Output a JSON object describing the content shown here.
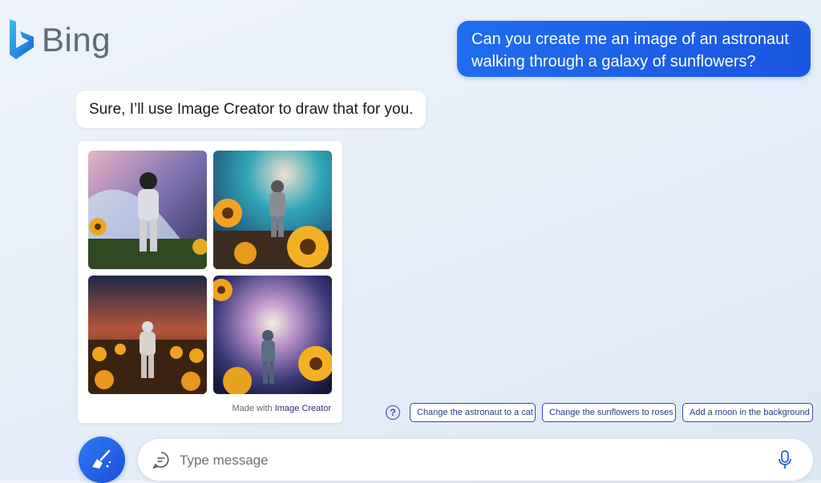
{
  "logo": {
    "text": "Bing"
  },
  "conversation": {
    "user_message": "Can you create me an image of an astronaut walking through a galaxy of sunflowers?",
    "bot_message": "Sure, I’ll use Image Creator to draw that for you.",
    "image_card": {
      "footer_prefix": "Made with",
      "footer_link": "Image Creator"
    }
  },
  "suggestions": [
    {
      "label": "Change the astronaut to a cat"
    },
    {
      "label": "Change the sunflowers to roses"
    },
    {
      "label": "Add a moon in the background"
    }
  ],
  "help_icon": {
    "glyph": "?"
  },
  "composer": {
    "placeholder": "Type message",
    "new_topic_icon": "broom-icon",
    "mic_icon": "microphone-icon"
  },
  "colors": {
    "accent": "#1a56e0",
    "chip_border": "#3a4aa0"
  }
}
